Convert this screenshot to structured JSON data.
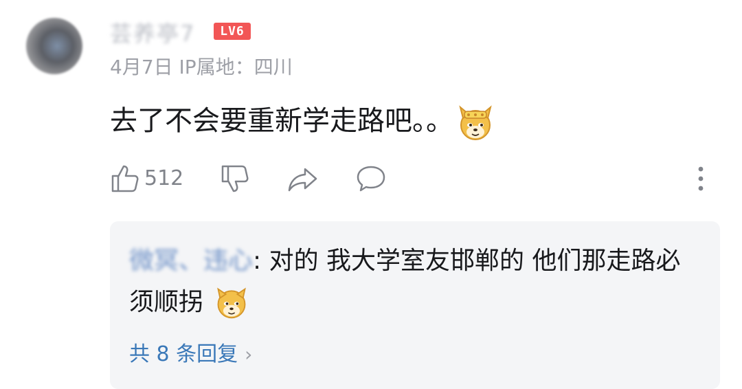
{
  "comment": {
    "username": "芸养亭7",
    "level_badge": "LV6",
    "date": "4月7日",
    "ip_location": "IP属地：四川",
    "text": "去了不会要重新学走路吧。。",
    "emoji": "doge-emoji-crown",
    "like_count": "512"
  },
  "actions": {
    "like_icon": "thumbs-up-icon",
    "dislike_icon": "thumbs-down-icon",
    "share_icon": "share-icon",
    "reply_icon": "comment-bubble-icon",
    "more_icon": "more-vertical-icon"
  },
  "reply": {
    "author": "微冥、违心",
    "separator": ":",
    "text": " 对的 我大学室友邯郸的 他们那走路必须顺拐",
    "emoji": "doge-emoji",
    "view_more": "共 8 条回复",
    "view_more_chevron": "›"
  },
  "colors": {
    "badge": "#f25656",
    "link": "#3a78b8",
    "muted": "#9d9fa6",
    "reply_bg": "#f4f5f7"
  }
}
